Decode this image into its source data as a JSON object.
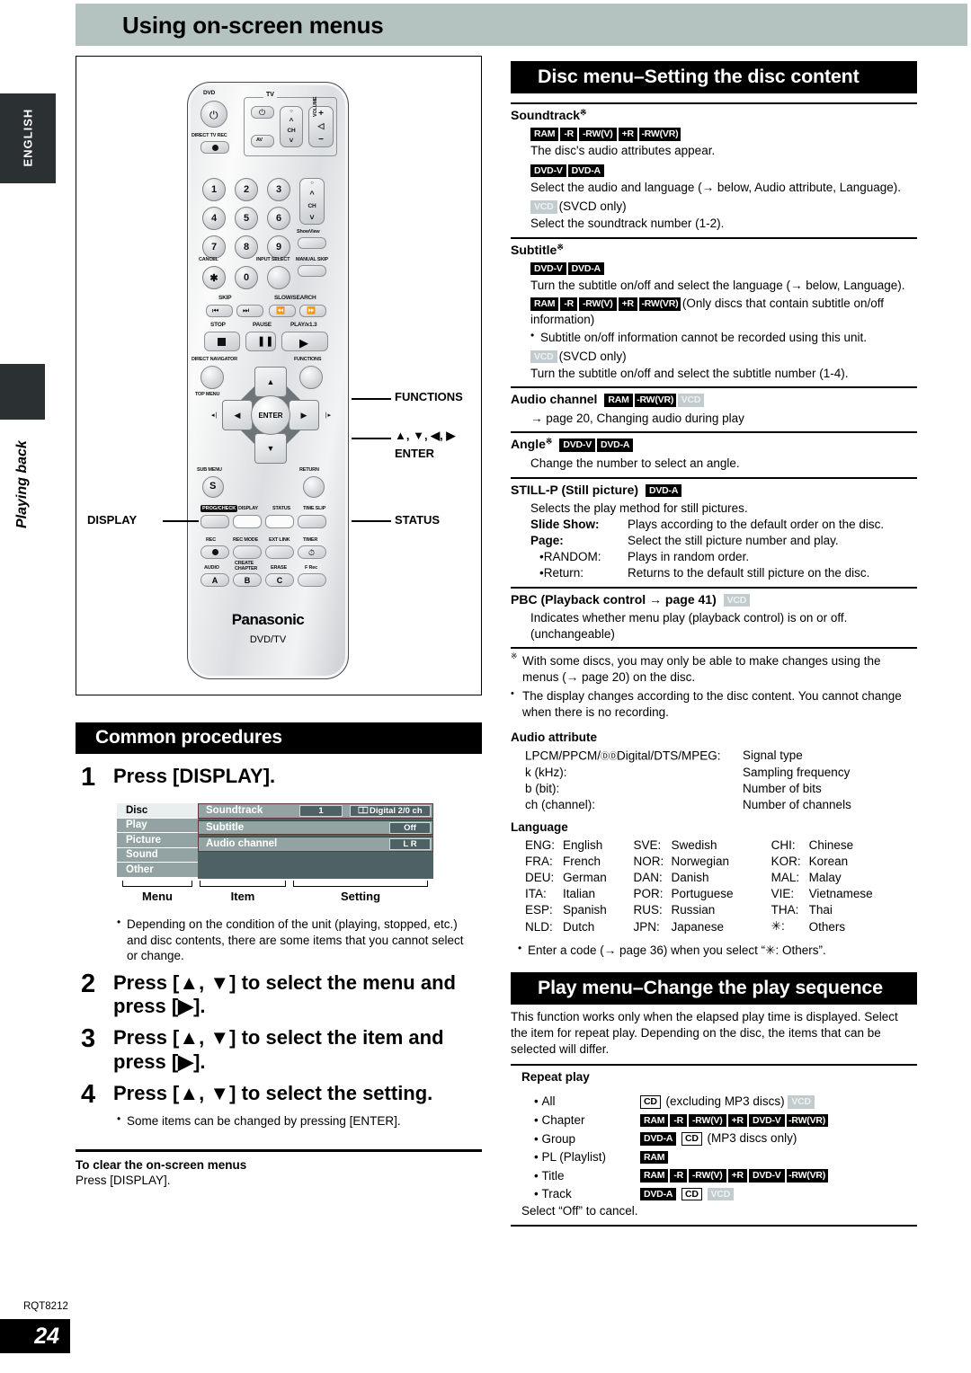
{
  "side": {
    "language_tab": "ENGLISH",
    "section_tab": "Playing back"
  },
  "header": {
    "title": "Using on-screen menus"
  },
  "remote": {
    "brand": "Panasonic",
    "model": "DVD/TV",
    "labels": {
      "dvd": "DVD",
      "tv": "TV",
      "direct_tv_rec": "DIRECT TV REC",
      "av": "AV",
      "ch": "CH",
      "volume": "VOLUME",
      "showview": "ShowView",
      "cancel": "CANCEL",
      "input_select": "INPUT SELECT",
      "manual_skip": "MANUAL SKIP",
      "skip": "SKIP",
      "slow_search": "SLOW/SEARCH",
      "stop": "STOP",
      "pause": "PAUSE",
      "play": "PLAY/x1.3",
      "direct_navigator": "DIRECT NAVIGATOR",
      "top_menu": "TOP MENU",
      "functions": "FUNCTIONS",
      "enter": "ENTER",
      "sub_menu": "SUB MENU",
      "return": "RETURN",
      "prog_check": "PROG/CHECK",
      "display": "DISPLAY",
      "status": "STATUS",
      "time_slip": "TIME SLIP",
      "rec": "REC",
      "rec_mode": "REC MODE",
      "ext_link": "EXT LINK",
      "timer": "TIMER",
      "audio": "AUDIO",
      "create_chapter": "CREATE\nCHAPTER",
      "erase": "ERASE",
      "f_rec": "F Rec",
      "a": "A",
      "b": "B",
      "c": "C",
      "s": "S"
    },
    "numbers": [
      "1",
      "2",
      "3",
      "4",
      "5",
      "6",
      "7",
      "8",
      "9",
      "0"
    ],
    "callouts": {
      "display": "DISPLAY",
      "functions": "FUNCTIONS",
      "arrows": "▲, ▼, ◀, ▶",
      "enter": "ENTER",
      "status": "STATUS"
    }
  },
  "common": {
    "bar_title": "Common procedures",
    "steps": [
      {
        "num": "1",
        "text": "Press [DISPLAY]."
      },
      {
        "num": "2",
        "text": "Press [▲, ▼] to select the menu and press [▶]."
      },
      {
        "num": "3",
        "text": "Press [▲, ▼] to select the item and press [▶]."
      },
      {
        "num": "4",
        "text": "Press [▲, ▼] to select the setting."
      }
    ],
    "note_step1": "Depending on the condition of the unit (playing, stopped, etc.) and disc contents, there are some items that you cannot select or change.",
    "note_step4": "Some items can be changed by pressing [ENTER].",
    "clear_heading": "To clear the on-screen menus",
    "clear_text": "Press [DISPLAY].",
    "osd": {
      "menu_items": [
        "Disc",
        "Play",
        "Picture",
        "Sound",
        "Other"
      ],
      "selected_menu": "Disc",
      "rows": [
        {
          "label": "Soundtrack",
          "value1": "1",
          "value2": "Digital   2/0 ch"
        },
        {
          "label": "Subtitle",
          "value1": "Off"
        },
        {
          "label": "Audio channel",
          "value1": "L R"
        }
      ],
      "captions": [
        "Menu",
        "Item",
        "Setting"
      ]
    }
  },
  "disc_menu": {
    "bar_title": "Disc menu–Setting the disc content",
    "sections": [
      {
        "heading": "Soundtrack",
        "heading_mark": "※",
        "blocks": [
          {
            "badges": [
              "RAM",
              "-R",
              "-RW(V)",
              "+R",
              "-RW(VR)"
            ],
            "text": "The disc's audio attributes appear."
          },
          {
            "badges": [
              "DVD-V",
              "DVD-A"
            ],
            "text": "Select the audio and language (→ below, Audio attribute, Language)."
          },
          {
            "badges": [
              "VCD"
            ],
            "inline_suffix": "(SVCD only)",
            "text": "Select the soundtrack number (1-2)."
          }
        ]
      },
      {
        "heading": "Subtitle",
        "heading_mark": "※",
        "blocks": [
          {
            "badges": [
              "DVD-V",
              "DVD-A"
            ],
            "text": "Turn the subtitle on/off and select the language (→ below, Language)."
          },
          {
            "badges": [
              "RAM",
              "-R",
              "-RW(V)",
              "+R",
              "-RW(VR)"
            ],
            "inline_suffix": "(Only discs that contain subtitle on/off information)"
          },
          {
            "bullet": "Subtitle on/off information cannot be recorded using this unit."
          },
          {
            "badges": [
              "VCD"
            ],
            "inline_suffix": "(SVCD only)",
            "text": "Turn the subtitle on/off and select the subtitle number (1-4)."
          }
        ]
      },
      {
        "heading": "Audio channel",
        "heading_badges": [
          "RAM",
          "-RW(VR)",
          "VCD"
        ],
        "blocks": [
          {
            "text": "→ page 20, Changing audio during play"
          }
        ]
      },
      {
        "heading": "Angle",
        "heading_mark": "※",
        "heading_badges": [
          "DVD-V",
          "DVD-A"
        ],
        "blocks": [
          {
            "text": "Change the number to select an angle."
          }
        ]
      },
      {
        "heading": "STILL-P (Still picture)",
        "heading_badges": [
          "DVD-A"
        ],
        "blocks": [
          {
            "text": "Selects the play method for still pictures."
          }
        ],
        "defs": [
          {
            "term": "Slide Show:",
            "desc": "Plays according to the default order on the disc.",
            "bold": true
          },
          {
            "term": "Page:",
            "desc": "Select the still picture number and play.",
            "bold": true
          },
          {
            "term": "RANDOM:",
            "desc": "Plays in random order.",
            "bullet": true
          },
          {
            "term": "Return:",
            "desc": "Returns to the default still picture on the disc.",
            "bullet": true
          }
        ]
      },
      {
        "heading": "PBC (Playback control → page 41)",
        "heading_badges": [
          "VCD"
        ],
        "blocks": [
          {
            "text": "Indicates whether menu play (playback control) is on or off. (unchangeable)"
          }
        ]
      }
    ],
    "footnotes": [
      {
        "mark": "※",
        "text": "With some discs, you may only be able to make changes using the menus (→ page 20) on the disc."
      },
      {
        "mark": "•",
        "text": "The display changes according to the disc content. You cannot change when there is no recording."
      }
    ],
    "audio_attribute": {
      "heading": "Audio attribute",
      "rows": [
        {
          "key": "LPCM/PPCM/",
          "key_logo": "ⒹⒹ",
          "key_tail": "Digital/DTS/MPEG:",
          "value": "Signal type"
        },
        {
          "key": "k (kHz):",
          "value": "Sampling frequency"
        },
        {
          "key": "b (bit):",
          "value": "Number of bits"
        },
        {
          "key": "ch (channel):",
          "value": "Number of channels"
        }
      ]
    },
    "language": {
      "heading": "Language",
      "rows": [
        [
          {
            "code": "ENG:",
            "name": "English"
          },
          {
            "code": "SVE:",
            "name": "Swedish"
          },
          {
            "code": "CHI:",
            "name": "Chinese"
          }
        ],
        [
          {
            "code": "FRA:",
            "name": "French"
          },
          {
            "code": "NOR:",
            "name": "Norwegian"
          },
          {
            "code": "KOR:",
            "name": "Korean"
          }
        ],
        [
          {
            "code": "DEU:",
            "name": "German"
          },
          {
            "code": "DAN:",
            "name": "Danish"
          },
          {
            "code": "MAL:",
            "name": "Malay"
          }
        ],
        [
          {
            "code": "ITA:",
            "name": "Italian"
          },
          {
            "code": "POR:",
            "name": "Portuguese"
          },
          {
            "code": "VIE:",
            "name": "Vietnamese"
          }
        ],
        [
          {
            "code": "ESP:",
            "name": "Spanish"
          },
          {
            "code": "RUS:",
            "name": "Russian"
          },
          {
            "code": "THA:",
            "name": "Thai"
          }
        ],
        [
          {
            "code": "NLD:",
            "name": "Dutch"
          },
          {
            "code": "JPN:",
            "name": "Japanese"
          },
          {
            "code": "✳:",
            "name": "Others"
          }
        ]
      ],
      "note": "Enter a code (→ page 36) when you select “✳: Others”."
    }
  },
  "play_menu": {
    "bar_title": "Play menu–Change the play sequence",
    "intro": "This function works only when the elapsed play time is displayed. Select the item for repeat play. Depending on the disc, the items that can be selected will differ.",
    "repeat_heading": "Repeat play",
    "rows": [
      {
        "label": "All",
        "badges": [
          "CD"
        ],
        "mid_text": "(excluding MP3 discs)",
        "badges_after": [
          "VCD"
        ]
      },
      {
        "label": "Chapter",
        "badges": [
          "RAM",
          "-R",
          "-RW(V)",
          "+R",
          "DVD-V",
          "-RW(VR)"
        ]
      },
      {
        "label": "Group",
        "badges": [
          "DVD-A",
          "CD"
        ],
        "mid_text": "(MP3 discs only)"
      },
      {
        "label": "PL (Playlist)",
        "badges": [
          "RAM"
        ]
      },
      {
        "label": "Title",
        "badges": [
          "RAM",
          "-R",
          "-RW(V)",
          "+R",
          "DVD-V",
          "-RW(VR)"
        ]
      },
      {
        "label": "Track",
        "badges": [
          "DVD-A",
          "CD",
          "VCD"
        ]
      }
    ],
    "cancel_note": "Select “Off” to cancel."
  },
  "footer": {
    "doc_code": "RQT8212",
    "page_number": "24"
  }
}
